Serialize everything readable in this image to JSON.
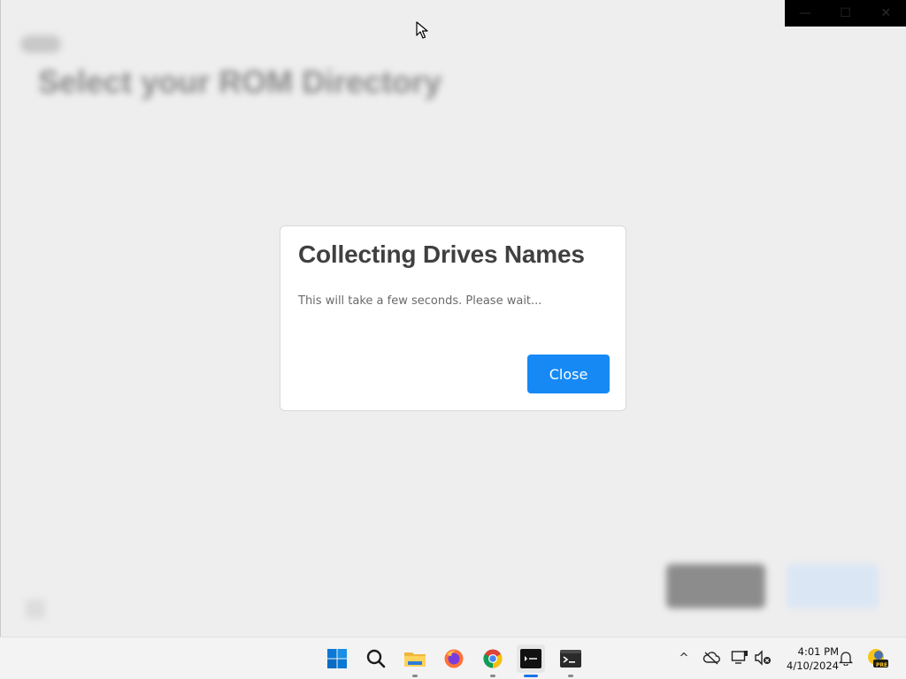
{
  "background_app": {
    "title": "Select your ROM Directory"
  },
  "window_controls": {
    "minimize": "—",
    "maximize": "☐",
    "close": "✕"
  },
  "dialog": {
    "title": "Collecting Drives Names",
    "message": "This will take a few seconds. Please wait...",
    "close_label": "Close",
    "accent_color": "#1689f5"
  },
  "taskbar": {
    "apps": [
      {
        "name": "start-icon"
      },
      {
        "name": "search-icon"
      },
      {
        "name": "file-explorer-icon"
      },
      {
        "name": "firefox-icon"
      },
      {
        "name": "chrome-icon"
      },
      {
        "name": "app-icon"
      },
      {
        "name": "terminal-icon"
      }
    ],
    "tray": {
      "chevron": "^",
      "time": "4:01 PM",
      "date": "4/10/2024",
      "badge": "PRE"
    }
  }
}
